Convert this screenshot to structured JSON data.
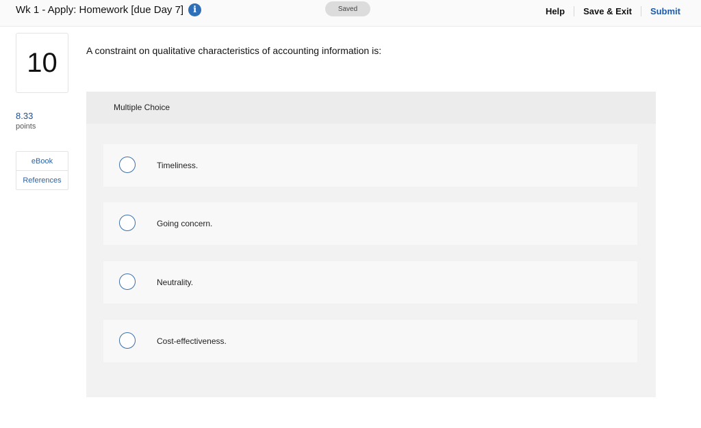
{
  "header": {
    "title": "Wk 1 - Apply: Homework [due Day 7]",
    "info_icon": "info-icon",
    "status": "Saved",
    "actions": {
      "help": "Help",
      "save_exit": "Save & Exit",
      "submit": "Submit"
    }
  },
  "sidebar": {
    "question_number": "10",
    "points_value": "8.33",
    "points_label": "points",
    "resources": [
      "eBook",
      "References"
    ]
  },
  "question": {
    "text": "A constraint on qualitative characteristics of accounting information is:",
    "type_label": "Multiple Choice",
    "options": [
      "Timeliness.",
      "Going concern.",
      "Neutrality.",
      "Cost-effectiveness."
    ]
  },
  "colors": {
    "accent": "#2f6fb8",
    "link": "#1e5aa8",
    "panel": "#f2f2f2"
  }
}
